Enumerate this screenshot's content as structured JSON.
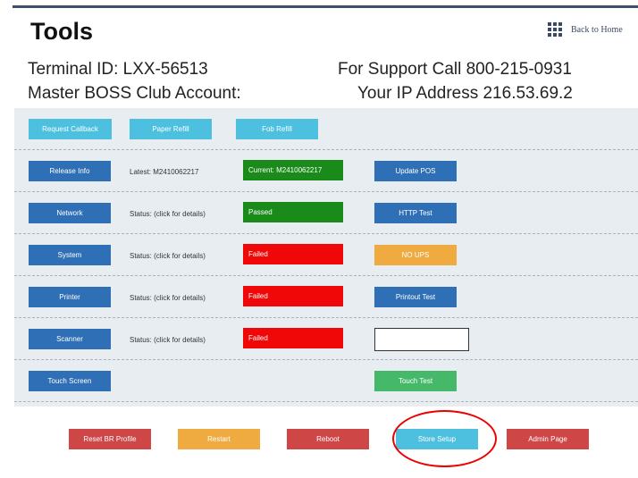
{
  "header": {
    "title": "Tools",
    "back_home_label": "Back to Home",
    "home_icon": "grid-icon"
  },
  "info": {
    "terminal_id": "Terminal ID: LXX-56513",
    "support": "For Support Call 800-215-0931",
    "account": "Master BOSS Club Account:",
    "ip": "Your IP Address 216.53.69.2"
  },
  "rows": {
    "callback_label": "Request Callback",
    "paper_label": "Paper Refill",
    "fob_label": "Fob Refill",
    "release_label": "Release Info",
    "release_latest": "Latest: M2410062217",
    "release_current": "Current: M2410062217",
    "update_pos_label": "Update POS",
    "network_label": "Network",
    "network_status": "Status: (click for details)",
    "network_result": "Passed",
    "http_test_label": "HTTP Test",
    "system_label": "System",
    "system_status": "Status: (click for details)",
    "system_result": "Failed",
    "no_ups_label": "NO UPS",
    "printer_label": "Printer",
    "printer_status": "Status: (click for details)",
    "printer_result": "Failed",
    "printout_test_label": "Printout Test",
    "scanner_label": "Scanner",
    "scanner_status": "Status: (click for details)",
    "scanner_result": "Failed",
    "touch_screen_label": "Touch Screen",
    "touch_test_label": "Touch Test"
  },
  "footer": {
    "reset_label": "Reset BR Profile",
    "restart_label": "Restart",
    "reboot_label": "Reboot",
    "store_setup_label": "Store Setup",
    "admin_label": "Admin Page"
  },
  "colors": {
    "blue": "#2f6fb5",
    "light_blue": "#4dc0e0",
    "pass_green": "#1a8a1a",
    "fail_red": "#f00808",
    "orange": "#efaa40",
    "annotation_red": "#e00000"
  }
}
